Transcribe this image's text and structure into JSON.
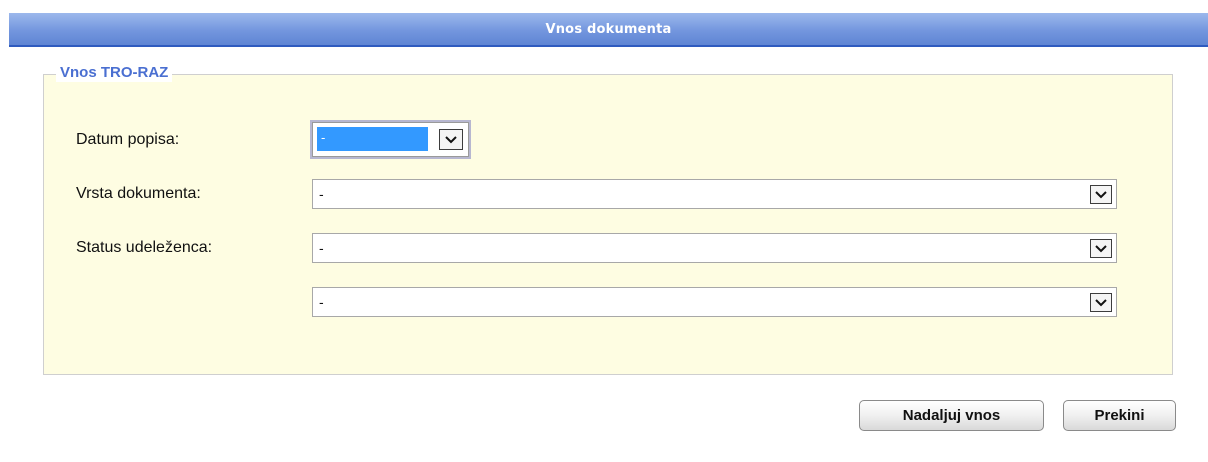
{
  "header": {
    "title": "Vnos dokumenta"
  },
  "form": {
    "legend": "Vnos TRO-RAZ",
    "fields": [
      {
        "label": "Datum popisa:",
        "value": "-"
      },
      {
        "label": "Vrsta dokumenta:",
        "value": "-"
      },
      {
        "label": "Status udeleženca:",
        "value": "-"
      },
      {
        "label": "",
        "value": "-"
      }
    ]
  },
  "actions": {
    "continue_label": "Nadaljuj vnos",
    "cancel_label": "Prekini"
  },
  "colors": {
    "header_bg": "#7396de",
    "legend_text": "#4a6fd1",
    "fieldset_bg": "#fefde2",
    "selected_highlight": "#3399ff"
  },
  "icons": {
    "dropdown": "chevron-down-icon"
  }
}
